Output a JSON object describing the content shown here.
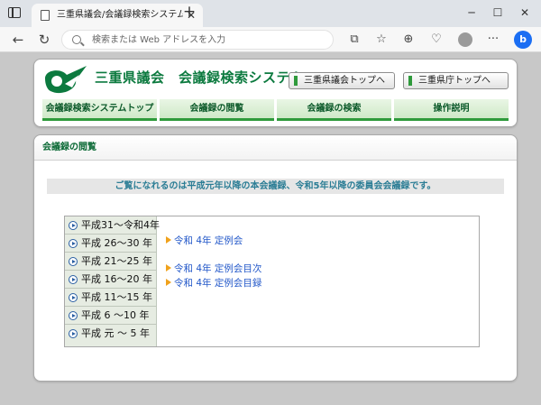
{
  "browser": {
    "tab_title": "三重県議会/会議録検索システム",
    "tab_close": "✕",
    "new_tab": "+",
    "address_placeholder": "検索または Web アドレスを入力",
    "win_minimize": "─",
    "win_maximize": "☐",
    "win_close": "✕",
    "back": "←",
    "reload": "↻",
    "bing_label": "b"
  },
  "header": {
    "site_title": "三重県議会　会議録検索システム",
    "links": [
      "三重県議会トップへ",
      "三重県庁トップへ"
    ],
    "menu": [
      "会議録検索システムトップ",
      "会議録の閲覧",
      "会議録の検索",
      "操作説明"
    ]
  },
  "section": {
    "title": "会議録の閲覧",
    "notice": "ご覧になれるのは平成元年以降の本会議録、令和5年以降の委員会会議録です。"
  },
  "eras": [
    "平成31～令和4年",
    "平成 26～30 年",
    "平成 21～25 年",
    "平成 16～20 年",
    "平成 11～15 年",
    "平成  6 ～10 年",
    "平成  元 ～ 5  年"
  ],
  "sessions": [
    "令和 4年 定例会",
    "令和 4年 定例会目次",
    "令和 4年 定例会目録"
  ],
  "colors": {
    "accent_green": "#2f9a3c",
    "title_green": "#0c7a3f",
    "link_blue": "#2358c9",
    "notice_teal": "#2b7d95",
    "arrow_orange": "#f0a21c"
  }
}
